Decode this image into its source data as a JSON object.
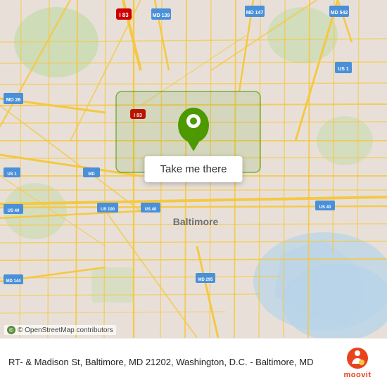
{
  "map": {
    "alt": "Map of Baltimore, MD area",
    "pin_color": "#4c9900",
    "highlight_color": "rgba(76,153,0,0.25)"
  },
  "button": {
    "label": "Take me there"
  },
  "osm": {
    "attribution": "© OpenStreetMap contributors"
  },
  "info": {
    "address": "RT- & Madison St, Baltimore, MD 21202, Washington, D.C. - Baltimore, MD"
  },
  "moovit": {
    "label": "moovit"
  }
}
